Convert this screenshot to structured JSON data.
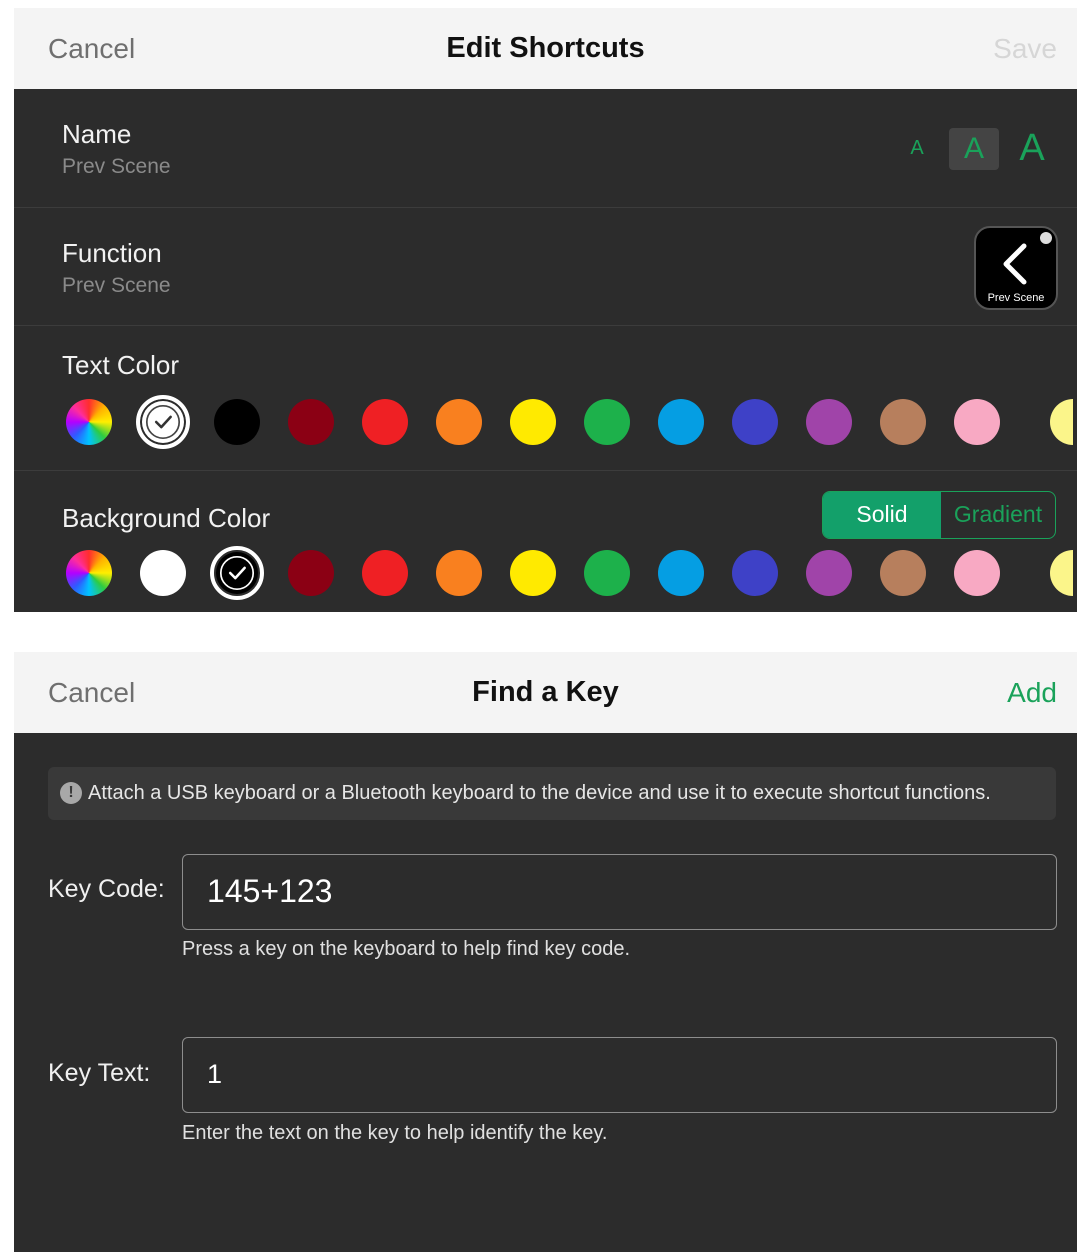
{
  "edit_shortcuts": {
    "topbar": {
      "cancel": "Cancel",
      "title": "Edit Shortcuts",
      "save": "Save"
    },
    "name": {
      "label": "Name",
      "value": "Prev Scene",
      "size_options": [
        "A",
        "A",
        "A"
      ],
      "selected_size_index": 1
    },
    "function": {
      "label": "Function",
      "value": "Prev Scene",
      "preview_label": "Prev Scene"
    },
    "text_color": {
      "label": "Text Color",
      "swatches": [
        "multicolor",
        "#ffffff",
        "#000000",
        "#8b0014",
        "#ef2024",
        "#f9801f",
        "#ffea00",
        "#1db14b",
        "#059ee3",
        "#3e41c7",
        "#a044a9",
        "#b77f5d",
        "#f8a9c3",
        "#fbf58a"
      ],
      "selected_index": 1
    },
    "background_color": {
      "label": "Background Color",
      "mode_options": [
        "Solid",
        "Gradient"
      ],
      "selected_mode": "Solid",
      "swatches": [
        "multicolor",
        "#ffffff",
        "#000000",
        "#8b0014",
        "#ef2024",
        "#f9801f",
        "#ffea00",
        "#1db14b",
        "#059ee3",
        "#3e41c7",
        "#a044a9",
        "#b77f5d",
        "#f8a9c3",
        "#fbf58a"
      ],
      "selected_index": 2
    }
  },
  "find_a_key": {
    "topbar": {
      "cancel": "Cancel",
      "title": "Find a Key",
      "add": "Add"
    },
    "notice": {
      "icon": "!",
      "text": "Attach a USB keyboard or a Bluetooth keyboard to the device and use it to execute shortcut functions."
    },
    "key_code": {
      "label": "Key Code:",
      "value": "145+123",
      "hint": "Press a key on the keyboard to help find key code."
    },
    "key_text": {
      "label": "Key Text:",
      "value": "1",
      "hint": "Enter the text on the key to help identify the key."
    }
  }
}
